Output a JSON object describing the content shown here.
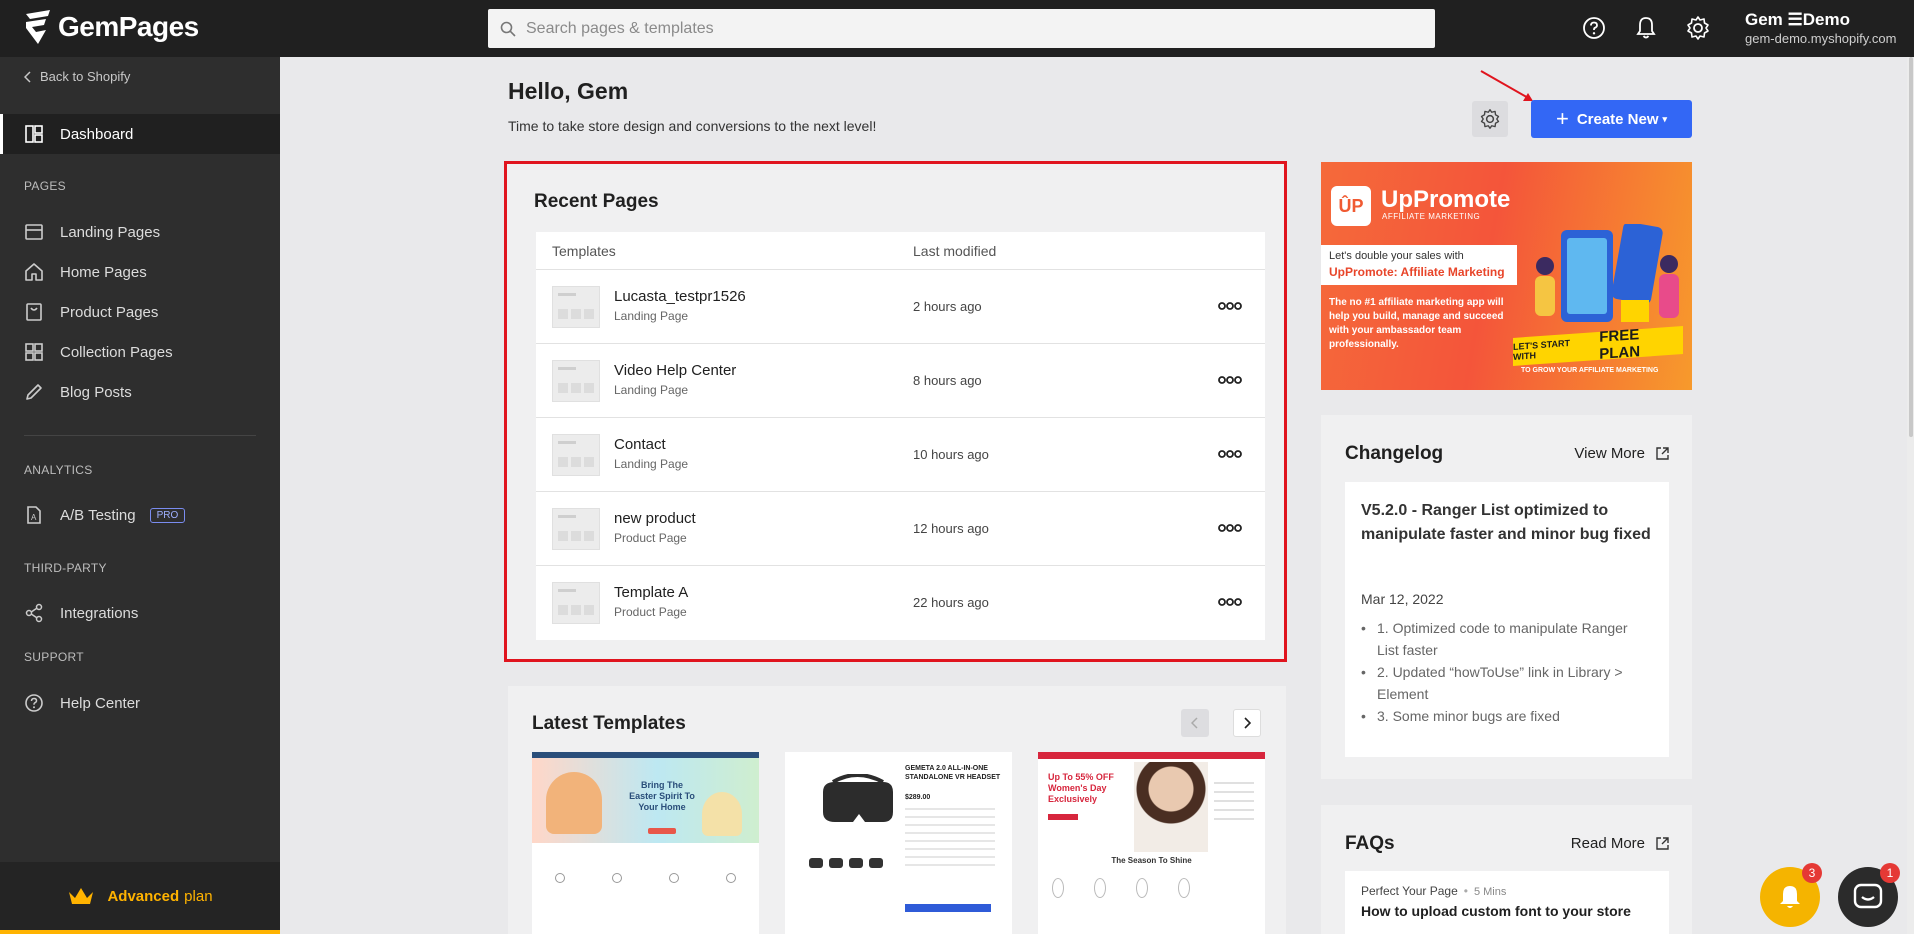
{
  "app": {
    "name": "GemPages"
  },
  "search": {
    "placeholder": "Search pages & templates"
  },
  "user": {
    "name": "Gem ☰Demo",
    "domain": "gem-demo.myshopify.com"
  },
  "sidebar": {
    "back_label": "Back to Shopify",
    "dashboard": "Dashboard",
    "sections": {
      "pages": "PAGES",
      "analytics": "ANALYTICS",
      "third_party": "THIRD-PARTY",
      "support": "SUPPORT"
    },
    "items": [
      {
        "label": "Landing Pages",
        "icon": "landing-pages-icon"
      },
      {
        "label": "Home Pages",
        "icon": "home-icon"
      },
      {
        "label": "Product Pages",
        "icon": "product-icon"
      },
      {
        "label": "Collection Pages",
        "icon": "collection-icon"
      },
      {
        "label": "Blog Posts",
        "icon": "pencil-icon"
      }
    ],
    "ab_testing": "A/B Testing",
    "pro_badge": "PRO",
    "integrations": "Integrations",
    "help_center": "Help Center",
    "plan": {
      "name": "Advanced",
      "word": "plan"
    }
  },
  "main": {
    "greeting": "Hello, Gem",
    "subtitle": "Time to take store design and conversions to the next level!",
    "create_label": "Create New",
    "recent": {
      "title": "Recent Pages",
      "col_templates": "Templates",
      "col_modified": "Last modified",
      "rows": [
        {
          "name": "Lucasta_testpr1526",
          "type": "Landing Page",
          "modified": "2 hours ago"
        },
        {
          "name": "Video Help Center",
          "type": "Landing Page",
          "modified": "8 hours ago"
        },
        {
          "name": "Contact",
          "type": "Landing Page",
          "modified": "10 hours ago"
        },
        {
          "name": "new product",
          "type": "Product Page",
          "modified": "12 hours ago"
        },
        {
          "name": "Template A",
          "type": "Product Page",
          "modified": "22 hours ago"
        }
      ]
    },
    "latest": {
      "title": "Latest Templates",
      "templates": [
        {
          "headline": "Bring The Easter Spirit To Your Home"
        },
        {
          "headline": "GEMETA 2.0 ALL-IN-ONE STANDALONE VR HEADSET",
          "price": "$289.00"
        },
        {
          "headline": "Up To 55% OFF Women's Day Exclusively",
          "sub": "The Season To Shine"
        }
      ]
    }
  },
  "promo": {
    "logo": "ÛP",
    "brand": "UpPromote",
    "tag": "AFFILIATE MARKETING",
    "line1": "Let's double your sales with",
    "line2": "UpPromote: Affiliate Marketing",
    "body": "The no #1 affiliate marketing app will help you build, manage and succeed with your ambassador team professionally.",
    "cta_prefix": "LET'S START WITH",
    "cta_main": "FREE PLAN",
    "cta_sub": "TO GROW YOUR AFFILIATE MARKETING"
  },
  "changelog": {
    "title": "Changelog",
    "view_more": "View More",
    "entry_title": "V5.2.0 - Ranger List optimized to manipulate faster and minor bug fixed",
    "date": "Mar 12, 2022",
    "items": [
      "1. Optimized code to manipulate Ranger List faster",
      "2. Updated “howToUse” link in Library > Element",
      "3. Some minor bugs are fixed"
    ]
  },
  "faqs": {
    "title": "FAQs",
    "read_more": "Read More",
    "category": "Perfect Your Page",
    "read_time": "5 Mins",
    "question": "How to upload custom font to your store"
  },
  "floating": {
    "bell_count": "3",
    "chat_count": "1"
  },
  "colors": {
    "accent": "#3367f5",
    "highlight": "#e0141e",
    "plan": "#ffb300"
  }
}
